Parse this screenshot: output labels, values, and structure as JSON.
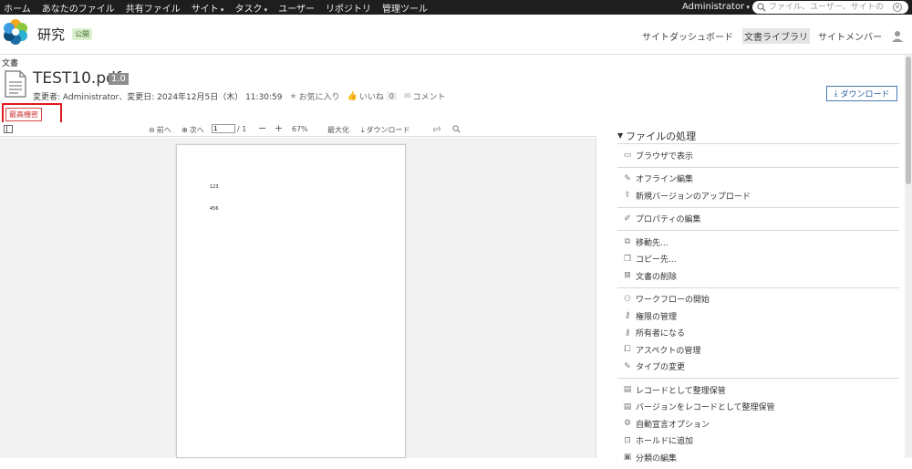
{
  "topnav": {
    "items": [
      "ホーム",
      "あなたのファイル",
      "共有ファイル",
      "サイト",
      "タスク",
      "ユーザー",
      "リポジトリ",
      "管理ツール"
    ],
    "user": "Administrator",
    "search_placeholder": "ファイル、ユーザー、サイトの"
  },
  "site": {
    "title": "研究",
    "badge": "公開",
    "nav": [
      "サイトダッシュボード",
      "文書ライブラリ",
      "サイトメンバー"
    ]
  },
  "document": {
    "breadcrumb": "文書",
    "title": "TEST10.pdf",
    "version": "1.0",
    "modified": "変更者: Administrator、変更日: 2024年12月5日（木）  11:30:59",
    "favorite": "お気に入り",
    "like": "いいね",
    "like_count": "0",
    "comment": "コメント",
    "download": "ダウンロード",
    "classification": "最高機密"
  },
  "viewer": {
    "prev": "前へ",
    "next": "次へ",
    "page_value": "1",
    "page_total": "/ 1",
    "zoom": "67%",
    "maximize": "最大化",
    "download": "ダウンロード",
    "page_lines": [
      "123",
      "456"
    ]
  },
  "actions": {
    "title": "ファイルの処理",
    "groups": [
      [
        "ブラウザで表示"
      ],
      [
        "オフライン編集",
        "新規バージョンのアップロード"
      ],
      [
        "プロパティの編集"
      ],
      [
        "移動先...",
        "コピー先...",
        "文書の削除"
      ],
      [
        "ワークフローの開始",
        "権限の管理",
        "所有者になる",
        "アスペクトの管理",
        "タイプの変更"
      ],
      [
        "レコードとして整理保管",
        "バージョンをレコードとして整理保管",
        "自動宣言オプション",
        "ホールドに追加",
        "分類の編集"
      ]
    ]
  },
  "colors": {
    "topbar": "#1e1e1e",
    "accent": "#2d62a0",
    "classification_border": "#e0191f"
  }
}
